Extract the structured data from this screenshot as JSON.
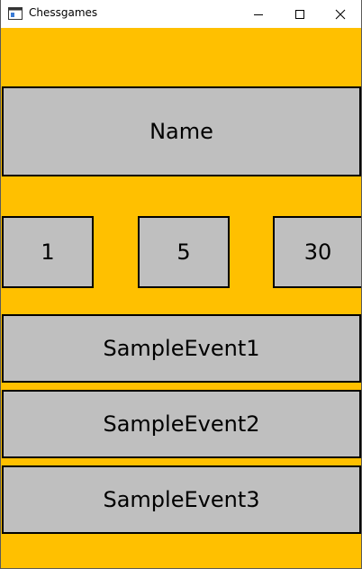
{
  "window": {
    "title": "Chessgames"
  },
  "colors": {
    "background": "#ffc000",
    "box_fill": "#bfbfbf",
    "border": "#000000"
  },
  "main": {
    "name_label": "Name",
    "numbers": [
      "1",
      "5",
      "30"
    ],
    "events": [
      "SampleEvent1",
      "SampleEvent2",
      "SampleEvent3"
    ]
  }
}
